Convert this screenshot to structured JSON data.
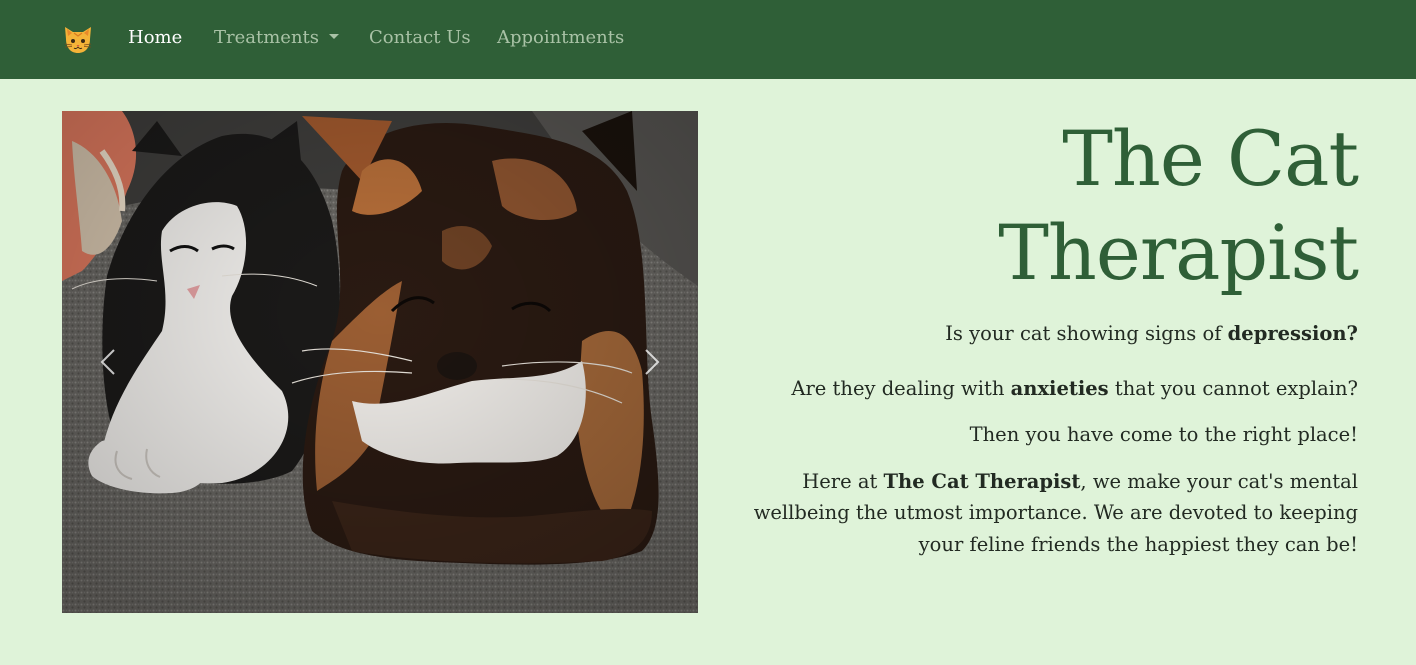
{
  "nav": {
    "logo_icon": "cat-face-icon",
    "items": [
      {
        "label": "Home",
        "active": true
      },
      {
        "label": "Treatments",
        "dropdown": true
      },
      {
        "label": "Contact Us"
      },
      {
        "label": "Appointments"
      }
    ]
  },
  "carousel": {
    "image_alt": "Two cats resting on a grey couch",
    "prev_icon": "chevron-left-icon",
    "next_icon": "chevron-right-icon"
  },
  "hero": {
    "title_line1": "The Cat",
    "title_line2": "Therapist",
    "p1_text": "Is your cat showing signs of ",
    "p1_bold": "depression?",
    "p2_pre": "Are they dealing with ",
    "p2_bold": "anxieties",
    "p2_post": " that you cannot explain?",
    "p3": "Then you have come to the right place!",
    "p4_pre": "Here at ",
    "p4_bold": "The Cat Therapist",
    "p4_post": ", we make your cat's mental wellbeing the utmost importance. We are devoted to keeping your feline friends the happiest they can be!"
  },
  "colors": {
    "navbar": "#2f5f37",
    "page_background": "#dff3d9",
    "title": "#2f5f37",
    "nav_link": "#a9c2a6",
    "nav_link_active": "#ffffff"
  }
}
